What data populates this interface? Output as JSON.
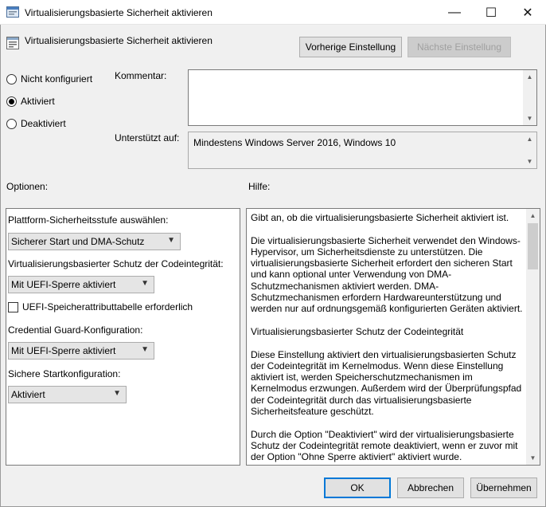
{
  "window": {
    "title": "Virtualisierungsbasierte Sicherheit aktivieren",
    "min_symbol": "—",
    "max_symbol": "☐",
    "close_symbol": "✕"
  },
  "header": {
    "setting_name": "Virtualisierungsbasierte Sicherheit aktivieren",
    "prev_button": "Vorherige Einstellung",
    "next_button": "Nächste Einstellung"
  },
  "state": {
    "options": [
      {
        "label": "Nicht konfiguriert",
        "selected": false
      },
      {
        "label": "Aktiviert",
        "selected": true
      },
      {
        "label": "Deaktiviert",
        "selected": false
      }
    ]
  },
  "comment": {
    "label": "Kommentar:",
    "value": ""
  },
  "supported": {
    "label": "Unterstützt auf:",
    "value": "Mindestens Windows Server 2016, Windows 10"
  },
  "options_panel": {
    "label": "Optionen:",
    "platform_label": "Plattform-Sicherheitsstufe auswählen:",
    "platform_value": "Sicherer Start und DMA-Schutz",
    "hvci_label": "Virtualisierungsbasierter Schutz der Codeintegrität:",
    "hvci_value": "Mit UEFI-Sperre aktiviert",
    "uefi_mat_label": "UEFI-Speicherattributtabelle erforderlich",
    "uefi_mat_checked": false,
    "credguard_label": "Credential Guard-Konfiguration:",
    "credguard_value": "Mit UEFI-Sperre aktiviert",
    "secure_launch_label": "Sichere Startkonfiguration:",
    "secure_launch_value": "Aktiviert"
  },
  "help_panel": {
    "label": "Hilfe:",
    "paragraphs": [
      "Gibt an, ob die virtualisierungsbasierte Sicherheit aktiviert ist.",
      "Die virtualisierungsbasierte Sicherheit verwendet den Windows-Hypervisor, um Sicherheitsdienste zu unterstützen. Die virtualisierungsbasierte Sicherheit erfordert den sicheren Start und kann optional unter Verwendung von DMA-Schutzmechanismen aktiviert werden. DMA-Schutzmechanismen erfordern Hardwareunterstützung und werden nur auf ordnungsgemäß konfigurierten Geräten aktiviert.",
      "Virtualisierungsbasierter Schutz der Codeintegrität",
      "Diese Einstellung aktiviert den virtualisierungsbasierten Schutz der Codeintegrität im Kernelmodus. Wenn diese Einstellung aktiviert ist, werden Speicherschutzmechanismen im Kernelmodus erzwungen. Außerdem wird der Überprüfungspfad der Codeintegrität durch das virtualisierungsbasierte Sicherheitsfeature geschützt.",
      "Durch die Option \"Deaktiviert\" wird der virtualisierungsbasierte Schutz der Codeintegrität remote deaktiviert, wenn er zuvor mit der Option \"Ohne Sperre aktiviert\" aktiviert wurde."
    ]
  },
  "footer": {
    "ok": "OK",
    "cancel": "Abbrechen",
    "apply": "Übernehmen"
  },
  "colors": {
    "accent": "#0078d7",
    "window_bg": "#f0f0f0"
  }
}
